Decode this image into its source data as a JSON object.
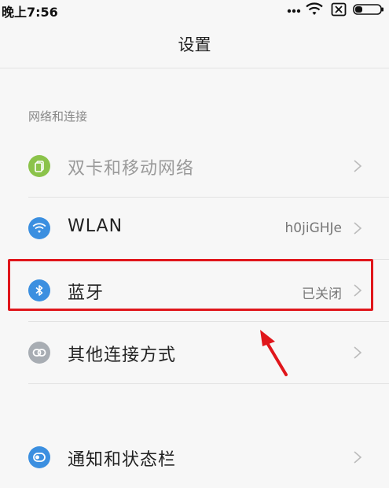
{
  "status_bar": {
    "time": "晚上7:56",
    "icons": [
      "more-dots-icon",
      "wifi-icon",
      "sim-card-icon",
      "battery-icon"
    ]
  },
  "header": {
    "title": "设置"
  },
  "section": {
    "title": "网络和连接"
  },
  "rows": [
    {
      "label": "双卡和移动网络",
      "value": "",
      "icon": "sim-cards-icon",
      "icon_color": "#8bc34a",
      "enabled": false
    },
    {
      "label": "WLAN",
      "value": "h0jiGHJe",
      "icon": "wifi-icon",
      "icon_color": "#3b8fe0",
      "enabled": true
    },
    {
      "label": "蓝牙",
      "value": "已关闭",
      "icon": "bluetooth-icon",
      "icon_color": "#3b8fe0",
      "enabled": true
    },
    {
      "label": "其他连接方式",
      "value": "",
      "icon": "link-icon",
      "icon_color": "#a8adb3",
      "enabled": true
    },
    {
      "label": "通知和状态栏",
      "value": "",
      "icon": "notification-icon",
      "icon_color": "#3b8fe0",
      "enabled": true
    }
  ],
  "annotation": {
    "color": "#e0161b",
    "highlight_target": "蓝牙"
  }
}
